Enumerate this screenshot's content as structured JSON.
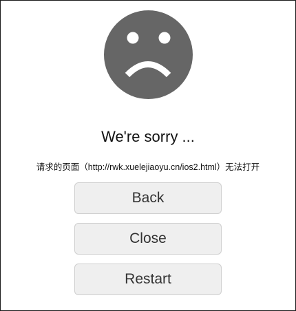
{
  "error": {
    "icon": "sad-face-icon",
    "title": "We're sorry ...",
    "message": "请求的页面（http://rwk.xuelejiaoyu.cn/ios2.html）无法打开"
  },
  "actions": {
    "back_label": "Back",
    "close_label": "Close",
    "restart_label": "Restart"
  },
  "colors": {
    "icon": "#666666",
    "button_bg": "#efefef",
    "button_border": "#cfcfcf",
    "text": "#111111"
  }
}
